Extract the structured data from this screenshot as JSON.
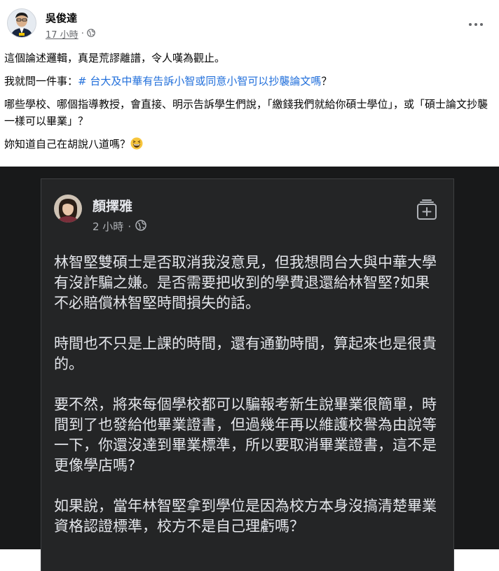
{
  "post": {
    "author": "吳俊達",
    "time": "17 小時",
    "separator": "·",
    "paragraphs": {
      "p1": "這個論述邏輯，真是荒謬離譜，令人嘆為觀止。",
      "p2_prefix": "我就問一件事：",
      "p2_hashtag": "# 台大及中華有告訴小智或同意小智可以抄襲論文嗎",
      "p2_suffix": "？",
      "p3": "哪些學校、哪個指導教授，會直接、明示告訴學生們說，「繳錢我們就給你碩士學位」，或「碩士論文抄襲一樣可以畢業」？",
      "p4": "妳知道自己在胡說八道嗎？"
    },
    "emoji": "grinning-sweat-emoji"
  },
  "embedded": {
    "author": "顏擇雅",
    "time": "2 小時",
    "separator": "·",
    "paragraphs": [
      "林智堅雙碩士是否取消我沒意見，但我想問台大與中華大學有沒詐騙之嫌。是否需要把收到的學費退還給林智堅?如果不必賠償林智堅時間損失的話。",
      "時間也不只是上課的時間，還有通勤時間，算起來也是很貴的。",
      "要不然，將來每個學校都可以騙報考新生說畢業很簡單，時間到了也發給他畢業證書，但過幾年再以維護校譽為由說等一下，你還沒達到畢業標準，所以要取消畢業證書，這不是更像學店嗎?",
      "如果說，當年林智堅拿到學位是因為校方本身沒搞清楚畢業資格認證標準，校方不是自己理虧嗎？"
    ]
  },
  "colors": {
    "hashtag": "#216fdb",
    "dark_bg": "#18191a",
    "card_bg": "#242526",
    "dark_text": "#e4e6eb",
    "dark_meta": "#b0b3b8"
  }
}
